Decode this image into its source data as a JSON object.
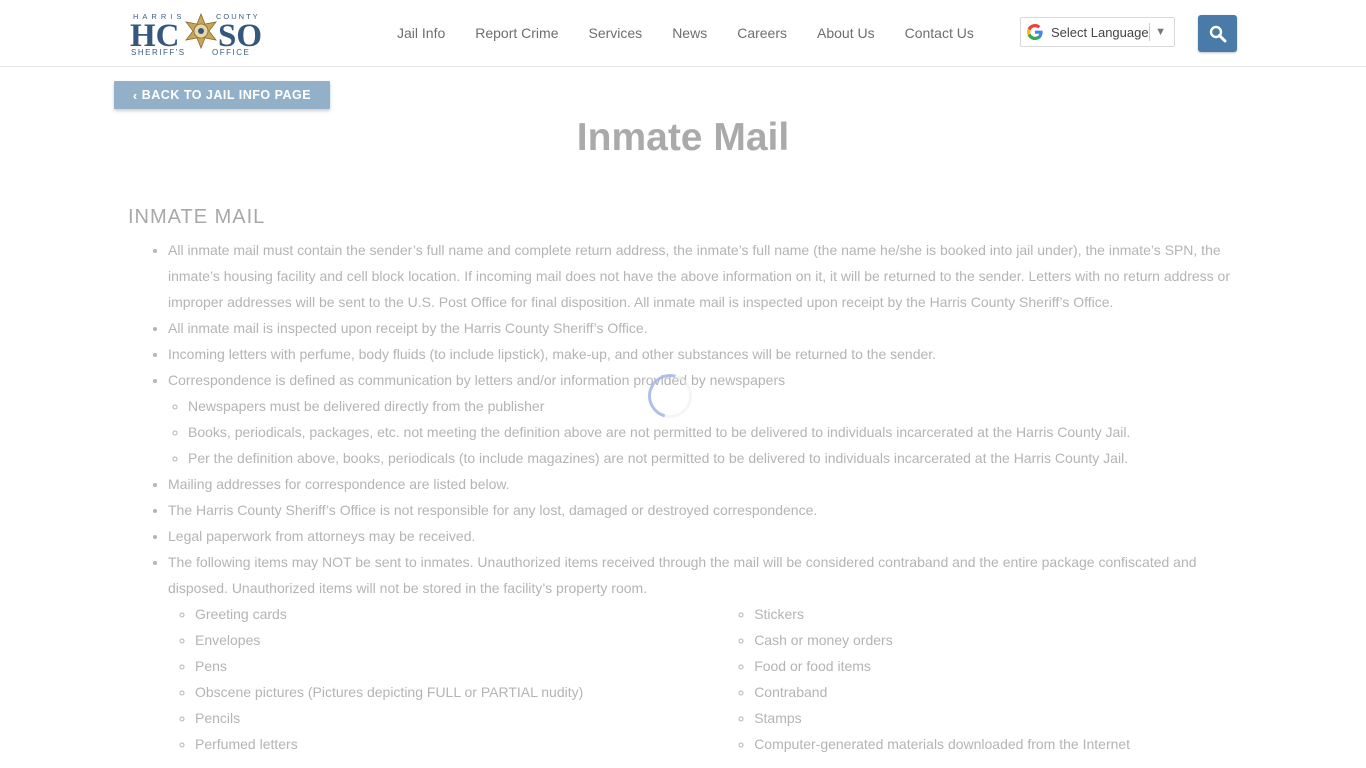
{
  "header": {
    "logo_text": "HARRIS COUNTY HCSO SHERIFF'S OFFICE",
    "nav": [
      "Jail Info",
      "Report Crime",
      "Services",
      "News",
      "Careers",
      "About Us",
      "Contact Us"
    ],
    "language_select": "Select Language",
    "search_icon": "search-icon"
  },
  "back_button": "BACK TO JAIL INFO PAGE",
  "page_title": "Inmate Mail",
  "section_heading": "INMATE MAIL",
  "items": [
    "All inmate mail must contain the sender’s full name and complete return address, the inmate’s full name (the name he/she is booked into jail under), the inmate’s SPN, the inmate’s housing facility and cell block location. If incoming mail does not have the above information on it, it will be returned to the sender. Letters with no return address or improper addresses will be sent to the U.S. Post Office for final disposition. All inmate mail is inspected upon receipt by the Harris County Sheriff’s Office.",
    "All inmate mail is inspected upon receipt by the Harris County Sheriff’s Office.",
    "Incoming letters with perfume, body fluids (to include lipstick), make-up, and other substances will be returned to the sender.",
    "Correspondence is defined as communication by letters and/or information provided by newspapers",
    "Mailing addresses for correspondence are listed below.",
    "The Harris County Sheriff’s Office is not responsible for any lost, damaged or destroyed correspondence.",
    "Legal paperwork from attorneys may be received.",
    "The following items may NOT be sent to inmates. Unauthorized items received through the mail will be considered contraband and the entire package confiscated and disposed. Unauthorized items will not be stored in the facility’s property room."
  ],
  "correspondence_subitems": [
    "Newspapers must be delivered directly from the publisher",
    "Books, periodicals, packages, etc. not meeting the definition above are not permitted to be delivered to individuals incarcerated at the Harris County Jail.",
    "Per the definition above, books, periodicals (to include magazines) are not permitted to be delivered to individuals incarcerated at the Harris County Jail."
  ],
  "prohibited_left": [
    "Greeting cards",
    "Envelopes",
    "Pens",
    "Obscene pictures (Pictures depicting FULL or PARTIAL nudity)",
    "Pencils",
    "Perfumed letters"
  ],
  "prohibited_right": [
    "Stickers",
    "Cash or money orders",
    "Food or food items",
    "Contraband",
    "Stamps",
    "Computer-generated materials downloaded from the Internet"
  ]
}
